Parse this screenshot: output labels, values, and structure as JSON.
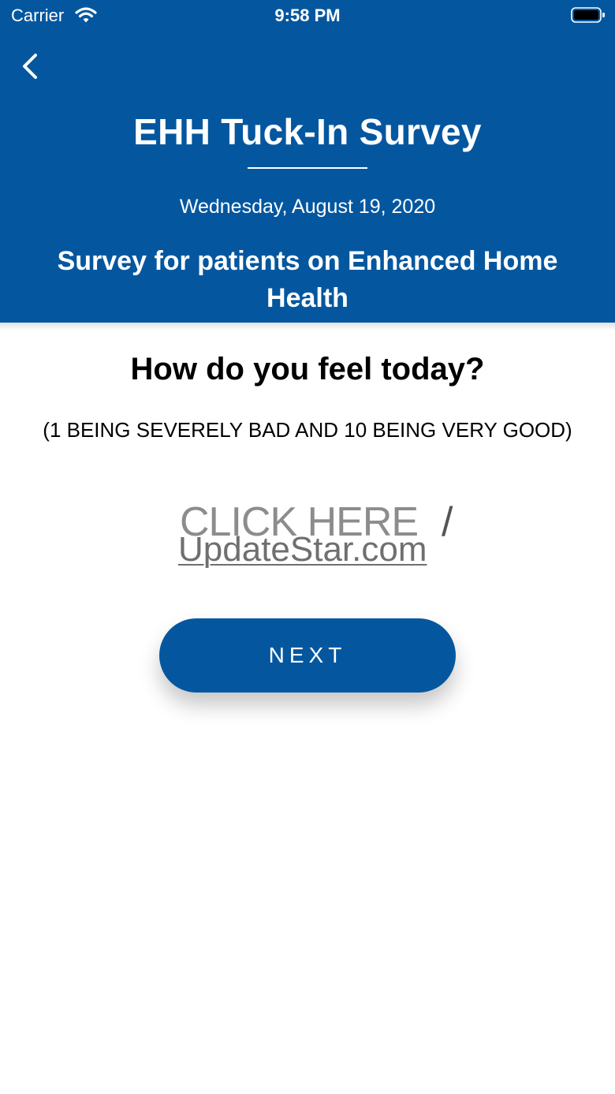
{
  "status_bar": {
    "carrier": "Carrier",
    "time": "9:58 PM",
    "wifi_icon": "wifi-icon",
    "battery_icon": "battery-icon"
  },
  "header": {
    "back_icon": "chevron-left-icon",
    "title": "EHH Tuck-In Survey",
    "date": "Wednesday, August 19, 2020",
    "subtitle": "Survey for patients on Enhanced Home Health",
    "background_color": "#04579f"
  },
  "question": {
    "text": "How do you feel today?",
    "scale_hint": "(1 BEING SEVERELY BAD AND 10 BEING VERY GOOD)"
  },
  "answer_link": {
    "label": "CLICK HERE",
    "separator": "/",
    "domain": "UpdateStar.com"
  },
  "next_button": {
    "label": "NEXT"
  }
}
